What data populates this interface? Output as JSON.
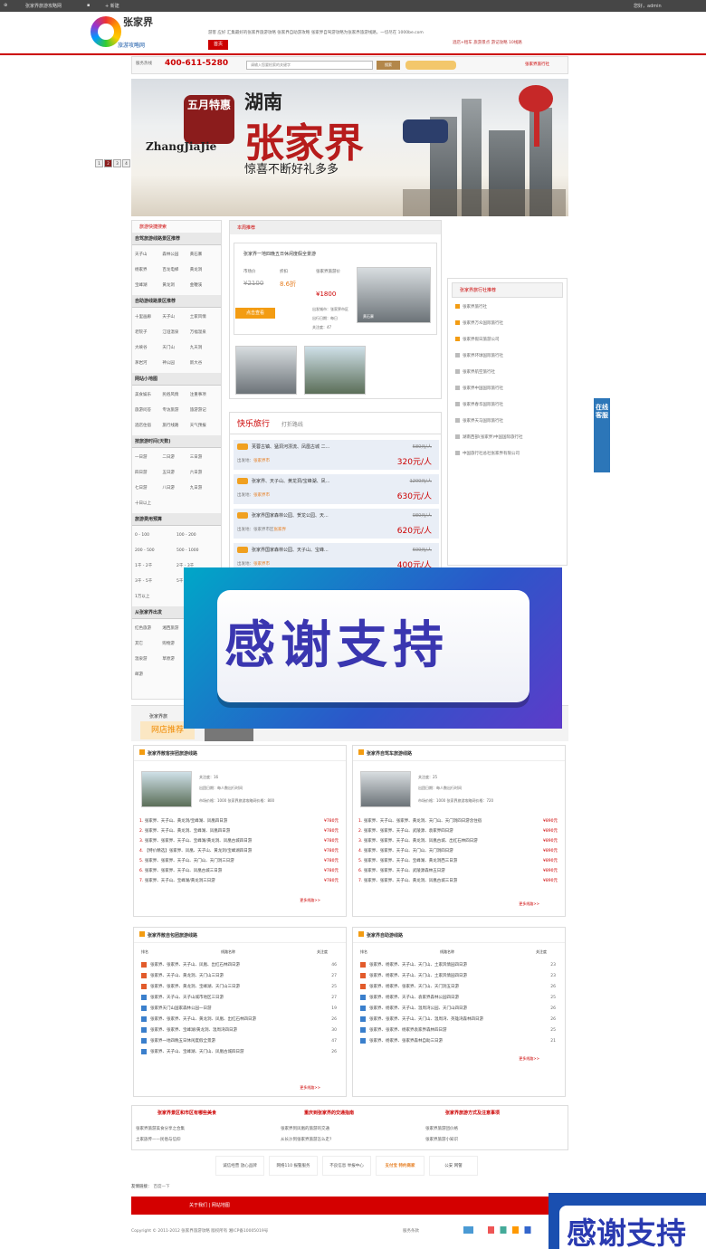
{
  "admin_bar": {
    "site": "张家界旅游攻略网",
    "new": "+ 新建",
    "user": "您好，admin"
  },
  "header": {
    "logo_title": "张家界",
    "logo_subtitle": "旅游攻略网",
    "tagline": "游客 应好 汇集最好的张家界旅游攻略 张家界自助游攻略 张家界自驾游攻略为张家界旅游线路，一切尽在 1000be.com",
    "home_tab": "首页",
    "links": "酒店+租车  旅游景点  游记攻略  10线路"
  },
  "search": {
    "hotline_label": "服务热线",
    "phone": "400-611-5280",
    "placeholder": "请输入您要检索的关键字",
    "button": "搜索",
    "right_link": "张家界旅行社"
  },
  "banner": {
    "badge": "五月特惠",
    "title_top": "湖南",
    "title_main": "张家界",
    "pinyin": "ZhangJiaJie",
    "subtitle": "惊喜不断好礼多多",
    "pages": [
      "1",
      "2",
      "3",
      "4"
    ],
    "active_page": 2
  },
  "sidebar": {
    "title": "旅游快捷搜索",
    "sections": [
      {
        "heading": "自驾旅游线路景区推荐",
        "items": [
          "天子山",
          "森林公园",
          "黄石寨",
          "杨家界",
          "百龙电梯",
          "黄龙洞",
          "宝峰湖",
          "黄龙洞",
          "金鞭溪"
        ]
      },
      {
        "heading": "自助游线路景区推荐",
        "items": [
          "十里画廊",
          "天子山",
          "土家风情",
          "老院子",
          "江垭温泉",
          "万福温泉",
          "大峡谷",
          "天门山",
          "九天洞",
          "茅岩河",
          "神公园",
          "新大谷"
        ]
      },
      {
        "heading": "网站小地图",
        "items": [
          "美食娱乐",
          "民俗风情",
          "注重事项",
          "旅游问答",
          "专访旅游",
          "旅游游记",
          "酒店住宿",
          "旅行线路",
          "天气预报"
        ]
      },
      {
        "heading": "按旅游时间(天数)",
        "items": [
          "一日游",
          "二日游",
          "三日游",
          "四日游",
          "五日游",
          "六日游",
          "七日游",
          "八日游",
          "九日游",
          "十日以上"
        ]
      },
      {
        "heading": "旅游费用预算",
        "items": [
          "0 - 100",
          "100 - 200",
          "200 - 500",
          "500 - 1000",
          "1千 - 2千",
          "2千 - 3千",
          "3千 - 5千",
          "5千 - 1万",
          "1万以上"
        ]
      },
      {
        "heading": "从张家界出发",
        "items": [
          "红色旅游",
          "湘西旅游",
          "凤凰游",
          "其它",
          "购物游",
          "深圳游",
          "温泉游",
          "草原游",
          "春季热卖",
          "邮游"
        ]
      }
    ]
  },
  "recommend": {
    "title": "本周推荐",
    "name": "张家界一地四晚五日休闲度假全景游",
    "labels": [
      "市场价",
      "折扣",
      "张家界旅游价"
    ],
    "market_price": "¥2100",
    "discount": "8.6折",
    "price": "¥1800",
    "dep_label": "出发城市：张家界市区",
    "days": "出行日期：每日",
    "views": "关注度：47",
    "button": "点击查看",
    "caption": "黄石寨"
  },
  "happy_travel": {
    "title": "快乐旅行",
    "subtitle": "打折路线",
    "items": [
      {
        "name": "芙蓉古镇、猛洞河漂流、凤凰古城 二...",
        "old": "580元/人",
        "price": "320元/人",
        "dep": "出发地：",
        "city": "张家界市"
      },
      {
        "name": "张家界、天子山、黄龙洞/宝峰湖、凤...",
        "old": "1200元/人",
        "price": "630元/人",
        "dep": "出发地：",
        "city": "张家界市"
      },
      {
        "name": "张家界国家森林公园、贺龙公园、天...",
        "old": "980元/人",
        "price": "620元/人",
        "dep": "出发地：张家界市区",
        "city": "张家界"
      },
      {
        "name": "张家界国家森林公园、天子山、宝峰...",
        "old": "600元/人",
        "price": "400元/人",
        "dep": "出发地：",
        "city": "张家界市"
      }
    ]
  },
  "agencies": {
    "title": "张家界旅行社推荐",
    "items": [
      "张家界旅行社",
      "张家界万众国际旅行社",
      "张家界假日旅游公司",
      "张家界环球国际旅行社",
      "张家界航空旅行社",
      "张家界中国国际旅行社",
      "张家界春华国际旅行社",
      "张家界天马国际旅行社",
      "湖南西部(张家界)中国国际旅行社",
      "中国旅行社总社张家界有限公司"
    ]
  },
  "kefu": "在线客服",
  "thanks": "感谢支持",
  "shop": {
    "tab": "网店推荐",
    "label": "张家界旅"
  },
  "panels": {
    "p1": {
      "title": "张家界散客拼团旅游线路",
      "meta": [
        "关注度：16",
        "出团日期：每人数出行时间",
        "市场价格：1000  张家界旅游攻略网价格：800"
      ],
      "lines": [
        {
          "t": "张家界、天子山、黄龙洞/宝峰湖、凤凰四日游",
          "p": "¥780元"
        },
        {
          "t": "张家界、天子山、黄龙洞、宝峰湖、凤凰四日游",
          "p": "¥780元"
        },
        {
          "t": "张家界、张家界、天子山、宝峰湖/黄龙洞、凤凰古城四日游",
          "p": "¥780元"
        },
        {
          "t": "【特价精选】张家界、凤凰、天子山、黄龙洞/宝峰湖四日游",
          "p": "¥780元"
        },
        {
          "t": "张家界、张家界、天子山、天门山、天门洞三日游",
          "p": "¥780元"
        },
        {
          "t": "张家界、张家界、天子山、凤凰古城三日游",
          "p": "¥780元"
        },
        {
          "t": "张家界、天子山、宝峰湖/黄龙洞三日游",
          "p": "¥780元"
        }
      ],
      "more": "更多线路>>"
    },
    "p2": {
      "title": "张家界自驾车旅游线路",
      "meta": [
        "关注度：25",
        "出团日期：每人数出行时间",
        "市场价格：1000  张家界旅游攻略网价格：720"
      ],
      "lines": [
        {
          "t": "张家界、天子山、张家界、黄龙洞、天门山、天门洞四日游含住宿",
          "p": "¥890元"
        },
        {
          "t": "张家界、张家界、天子山、武陵源、袁家界四日游",
          "p": "¥890元"
        },
        {
          "t": "张家界、张家界、天子山、黄龙洞、凤凰古城、出红石林四日游",
          "p": "¥890元"
        },
        {
          "t": "张家界、张家界、天子山、天门山、天门洞四日游",
          "p": "¥890元"
        },
        {
          "t": "张家界、张家界、天子山、宝峰湖、黄龙洞西三日游",
          "p": "¥890元"
        },
        {
          "t": "张家界、张家界、天子山、武陵源森林五日游",
          "p": "¥890元"
        },
        {
          "t": "张家界、张家界、天子山、黄龙洞、凤凰古城三日游",
          "p": "¥890元"
        }
      ],
      "more": "更多线路>>"
    },
    "p3": {
      "title": "张家界散自包团旅游线路",
      "cols": [
        "排名",
        "线路名称",
        "关注度"
      ],
      "rows": [
        {
          "t": "张家界、张家界、天子山、凤凰、出红石林四日游",
          "c": "46"
        },
        {
          "t": "张家界、天子山、黄龙洞、天门山三日游",
          "c": "27"
        },
        {
          "t": "张家界、张家界、黄龙洞、宝峰湖、天门山三日游",
          "c": "25"
        },
        {
          "t": "张家界、天子山、天子山城市地区三日游",
          "c": "27"
        },
        {
          "t": "张家界天门山国家森林公园一日游",
          "c": "19"
        },
        {
          "t": "张家界、张家界、天子山、黄龙洞、凤凰、出红石林四日游",
          "c": "26"
        },
        {
          "t": "张家界、张家界、宝峰湖/黄龙洞、温周湾四日游",
          "c": "30"
        },
        {
          "t": "张家界一地四晚五日休闲度假全景游",
          "c": "47"
        },
        {
          "t": "张家界、天子山、宝峰湖、天门山、凤凰古城四日游",
          "c": "26"
        }
      ],
      "more": "更多线路>>"
    },
    "p4": {
      "title": "张家界自助游线路",
      "cols": [
        "排名",
        "线路名称",
        "关注度"
      ],
      "rows": [
        {
          "t": "张家界、杨家界、天子山、天门山、土家风情园四日游",
          "c": "23"
        },
        {
          "t": "张家界、杨家界、天子山、天门山、土家风情园四日游",
          "c": "23"
        },
        {
          "t": "张家界、杨家界、张家界、天门山、天门洞五日游",
          "c": "26"
        },
        {
          "t": "张家界、杨家界、天子山、袁家界森林公园四日游",
          "c": "25"
        },
        {
          "t": "张家界、杨家界、天子山、温周湾公园、天门山四日游",
          "c": "26"
        },
        {
          "t": "张家界、张家界、天子山、天门山、温周湾、英雄湾森林四日游",
          "c": "26"
        },
        {
          "t": "张家界、张家界、杨家界袁家界森林四日游",
          "c": "25"
        },
        {
          "t": "张家界、杨家界、张家界森林自助三日游",
          "c": "21"
        }
      ],
      "more": "更多线路>>"
    }
  },
  "footer_cols": [
    {
      "title": "张家界景区和市区有哪些美食",
      "links": [
        "张家界旅游美食分享之合集",
        "土家族传——民俗与信仰"
      ]
    },
    {
      "title": "重庆到张家界的交通指南",
      "links": [
        "张家界到凤凰的旅游的交通",
        "从长沙到张家界旅游怎么走?"
      ]
    },
    {
      "title": "张家界旅游方式及注意事项",
      "links": [
        "张家界旅游团价格",
        "张家界旅游小知识"
      ]
    }
  ],
  "partner_logos": [
    "诚信经营 放心品牌",
    "网络110 报警服务",
    "不良信息 举报中心",
    "支付宝 特约商家",
    "公安 网警"
  ],
  "friend_links_label": "友情链接：",
  "friend_links_value": "百度一下",
  "footer_nav": "关于我们  |  网站地图",
  "copyright": "Copyright © 2011-2012 张家界旅游攻略 版权所有 湘ICP备10005019号",
  "footer_mid": "服务条款",
  "thanks_corner": "感谢支持"
}
